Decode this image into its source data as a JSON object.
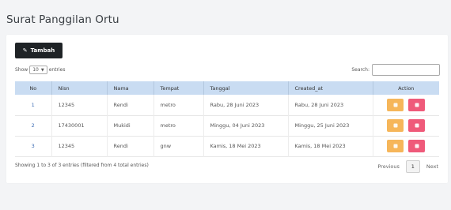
{
  "page": {
    "title": "Surat Panggilan Ortu"
  },
  "toolbar": {
    "add_label": "Tambah",
    "add_icon": "edit-icon"
  },
  "length": {
    "prefix": "Show",
    "value": "10",
    "suffix": "entries"
  },
  "search": {
    "label": "Search:",
    "value": ""
  },
  "table": {
    "headers": [
      "No",
      "Nisn",
      "Nama",
      "Tempat",
      "Tanggal",
      "Created_at",
      "Action"
    ],
    "rows": [
      {
        "no": "1",
        "nisn": "12345",
        "nama": "Rendi",
        "tempat": "metro",
        "tanggal": "Rabu, 28 Juni 2023",
        "created_at": "Rabu, 28 Juni 2023"
      },
      {
        "no": "2",
        "nisn": "17430001",
        "nama": "Mukidi",
        "tempat": "metro",
        "tanggal": "Minggu, 04 Juni 2023",
        "created_at": "Minggu, 25 Juni 2023"
      },
      {
        "no": "3",
        "nisn": "12345",
        "nama": "Rendi",
        "tempat": "gnw",
        "tanggal": "Kamis, 18 Mei 2023",
        "created_at": "Kamis, 18 Mei 2023"
      }
    ],
    "action_colors": {
      "edit": "#f6b65a",
      "delete": "#ef5a7a"
    }
  },
  "footer": {
    "info": "Showing 1 to 3 of 3 entries (filtered from 4 total entries)",
    "previous": "Previous",
    "current_page": "1",
    "next": "Next"
  },
  "colors": {
    "header_bg": "#c9dcf2",
    "add_button_bg": "#1f2326"
  }
}
